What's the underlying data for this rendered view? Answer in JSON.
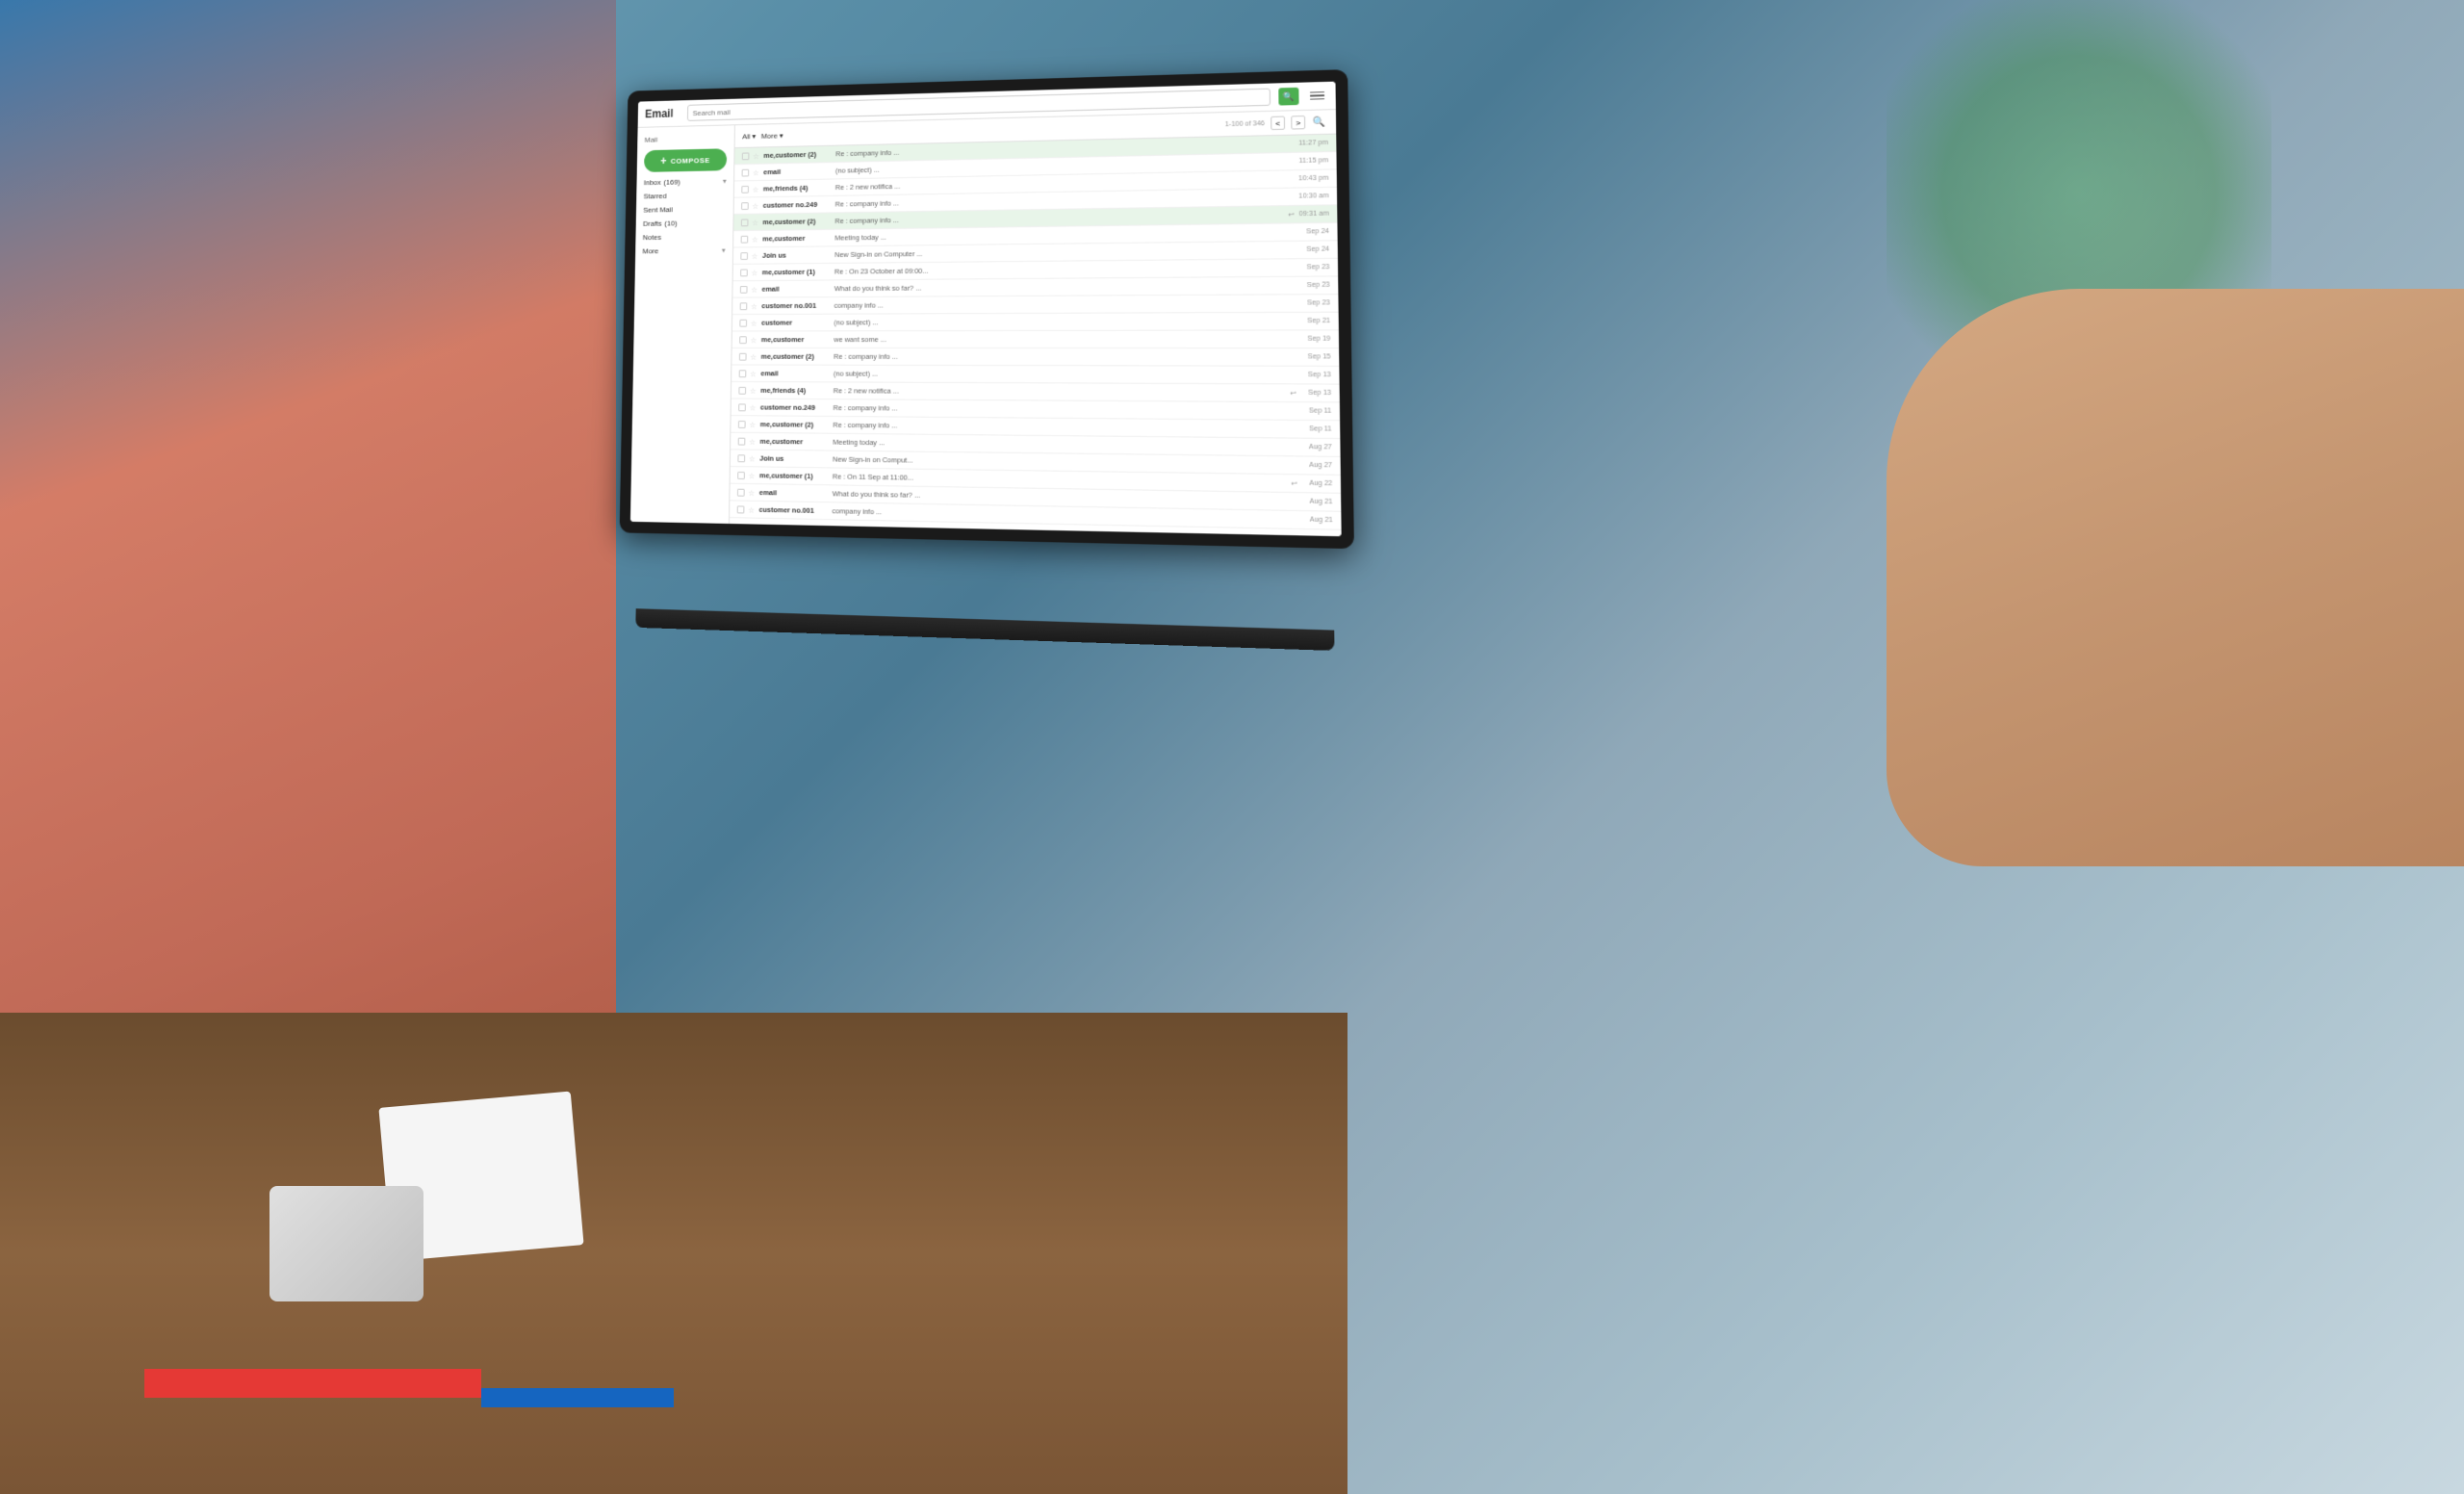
{
  "app": {
    "title": "Email",
    "header_search_placeholder": "Search mail",
    "menu_icon": "≡",
    "search_icon": "🔍"
  },
  "sidebar": {
    "label": "Mail",
    "compose_label": "COMPOSE",
    "items": [
      {
        "label": "Inbox",
        "count": "(169)",
        "has_arrow": true
      },
      {
        "label": "Starred",
        "count": "",
        "has_arrow": false
      },
      {
        "label": "Sent Mail",
        "count": "",
        "has_arrow": false
      },
      {
        "label": "Drafts",
        "count": "(10)",
        "has_arrow": false
      },
      {
        "label": "Notes",
        "count": "",
        "has_arrow": false
      },
      {
        "label": "More",
        "count": "",
        "has_arrow": true
      }
    ]
  },
  "toolbar": {
    "select_label": "All",
    "more_label": "More",
    "count_label": "1-100 of 346",
    "nav_prev": "<",
    "nav_next": ">"
  },
  "emails": [
    {
      "sender": "me,customer (2)",
      "subject": "Re : company info ...",
      "time": "11:27 pm",
      "starred": false,
      "highlighted": true,
      "has_reply_icon": false
    },
    {
      "sender": "email",
      "subject": "(no subject) ...",
      "time": "11:15 pm",
      "starred": false,
      "highlighted": false,
      "has_reply_icon": false
    },
    {
      "sender": "me,friends (4)",
      "subject": "Re : 2 new notifica ...",
      "time": "10:43 pm",
      "starred": false,
      "highlighted": false,
      "has_reply_icon": false
    },
    {
      "sender": "customer no.249",
      "subject": "Re : company info ...",
      "time": "10:30 am",
      "starred": false,
      "highlighted": false,
      "has_reply_icon": false
    },
    {
      "sender": "me,customer (2)",
      "subject": "Re : company info ...",
      "time": "09:31 am",
      "starred": false,
      "highlighted": true,
      "has_reply_icon": true
    },
    {
      "sender": "me,customer",
      "subject": "Meeting today ...",
      "time": "Sep 24",
      "starred": false,
      "highlighted": false,
      "has_reply_icon": false
    },
    {
      "sender": "Join us",
      "subject": "New Sign-in on Computer ...",
      "time": "Sep 24",
      "starred": false,
      "highlighted": false,
      "has_reply_icon": false
    },
    {
      "sender": "me,customer (1)",
      "subject": "Re : On 23 October at 09:00...",
      "time": "Sep 23",
      "starred": false,
      "highlighted": false,
      "has_reply_icon": false
    },
    {
      "sender": "email",
      "subject": "What do you think so far? ...",
      "time": "Sep 23",
      "starred": false,
      "highlighted": false,
      "has_reply_icon": false
    },
    {
      "sender": "customer no.001",
      "subject": "company info ...",
      "time": "Sep 23",
      "starred": false,
      "highlighted": false,
      "has_reply_icon": false
    },
    {
      "sender": "customer",
      "subject": "(no subject) ...",
      "time": "Sep 21",
      "starred": false,
      "highlighted": false,
      "has_reply_icon": false
    },
    {
      "sender": "me,customer",
      "subject": "we want some ...",
      "time": "Sep 19",
      "starred": false,
      "highlighted": false,
      "has_reply_icon": false
    },
    {
      "sender": "me,customer (2)",
      "subject": "Re : company info ...",
      "time": "Sep 15",
      "starred": false,
      "highlighted": false,
      "has_reply_icon": false
    },
    {
      "sender": "email",
      "subject": "(no subject) ...",
      "time": "Sep 13",
      "starred": false,
      "highlighted": false,
      "has_reply_icon": false
    },
    {
      "sender": "me,friends (4)",
      "subject": "Re : 2 new notifica ...",
      "time": "Sep 13",
      "starred": false,
      "highlighted": false,
      "has_reply_icon": true
    },
    {
      "sender": "customer no.249",
      "subject": "Re : company info ...",
      "time": "Sep 11",
      "starred": false,
      "highlighted": false,
      "has_reply_icon": false
    },
    {
      "sender": "me,customer (2)",
      "subject": "Re : company info ...",
      "time": "Sep 11",
      "starred": false,
      "highlighted": false,
      "has_reply_icon": false
    },
    {
      "sender": "me,customer",
      "subject": "Meeting today ...",
      "time": "Aug 27",
      "starred": false,
      "highlighted": false,
      "has_reply_icon": false
    },
    {
      "sender": "Join us",
      "subject": "New Sign-in on Comput...",
      "time": "Aug 27",
      "starred": false,
      "highlighted": false,
      "has_reply_icon": false
    },
    {
      "sender": "me,customer (1)",
      "subject": "Re : On 11 Sep at 11:00...",
      "time": "Aug 22",
      "starred": false,
      "highlighted": false,
      "has_reply_icon": true
    },
    {
      "sender": "email",
      "subject": "What do you think so far? ...",
      "time": "Aug 21",
      "starred": false,
      "highlighted": false,
      "has_reply_icon": false
    },
    {
      "sender": "customer no.001",
      "subject": "company info ...",
      "time": "Aug 21",
      "starred": false,
      "highlighted": false,
      "has_reply_icon": false
    }
  ],
  "colors": {
    "compose_bg": "#4caf50",
    "search_btn_bg": "#4caf50",
    "highlight_row": "#e8f5e9",
    "accent": "#4caf50"
  }
}
